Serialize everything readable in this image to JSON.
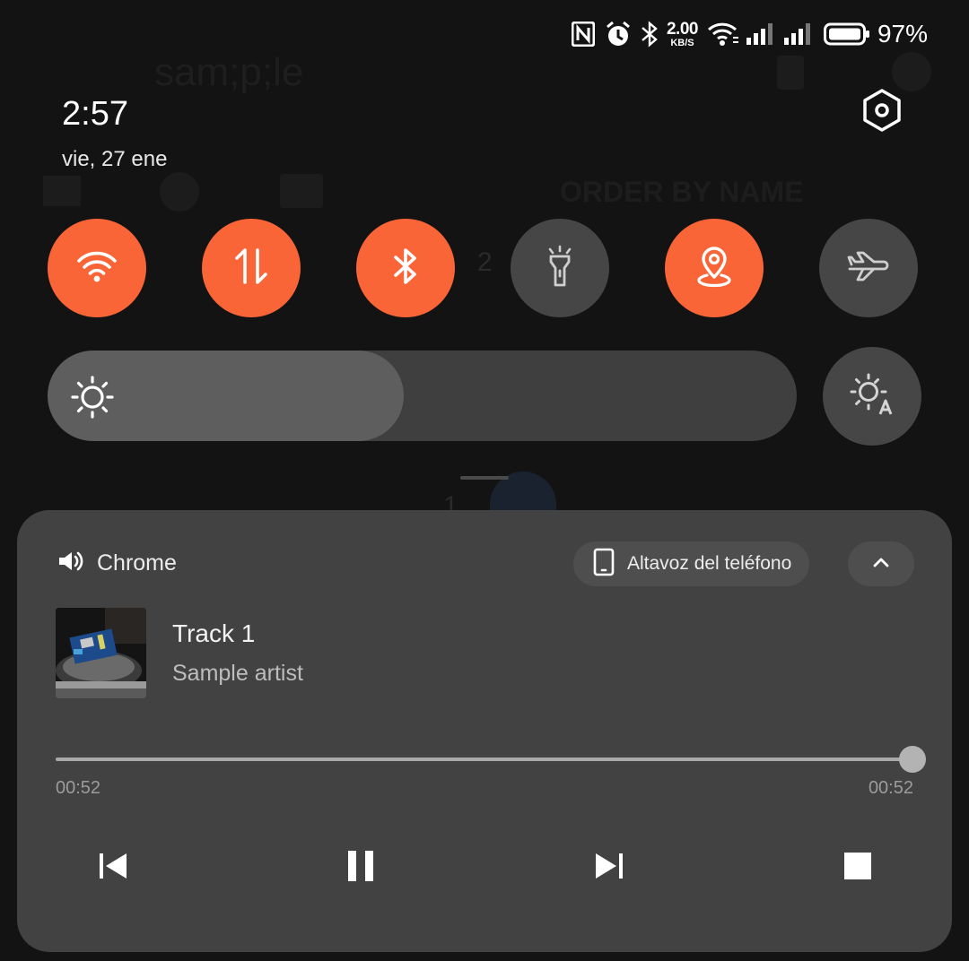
{
  "background_app": {
    "title": "sam;p;le",
    "order_label": "ORDER BY NAME",
    "numbers": [
      "2",
      "1"
    ]
  },
  "status_bar": {
    "icons": [
      "nfc-icon",
      "alarm-icon",
      "bluetooth-icon",
      "wifi-icon",
      "signal-icon",
      "signal-icon",
      "battery-icon"
    ],
    "net_speed_value": "2.00",
    "net_speed_unit": "KB/S",
    "battery_percent": "97%"
  },
  "header": {
    "time": "2:57",
    "date": "vie, 27 ene"
  },
  "quick_toggles": [
    {
      "name": "wifi",
      "icon": "wifi-icon",
      "state": "on"
    },
    {
      "name": "mobile-data",
      "icon": "data-arrows-icon",
      "state": "on"
    },
    {
      "name": "bluetooth",
      "icon": "bluetooth-icon",
      "state": "on"
    },
    {
      "name": "flashlight",
      "icon": "flashlight-icon",
      "state": "off"
    },
    {
      "name": "location",
      "icon": "location-icon",
      "state": "on"
    },
    {
      "name": "airplane",
      "icon": "airplane-icon",
      "state": "off"
    }
  ],
  "brightness": {
    "level": 0.475,
    "auto_icon": "auto-brightness-icon"
  },
  "media": {
    "app_name": "Chrome",
    "output_device": "Altavoz del teléfono",
    "track_title": "Track 1",
    "artist": "Sample artist",
    "current_time": "00:52",
    "duration": "00:52",
    "progress": 1.0
  },
  "colors": {
    "accent": "#fa6537",
    "toggle_off": "#464646",
    "card": "#424242",
    "panel_bg": "#131314"
  }
}
